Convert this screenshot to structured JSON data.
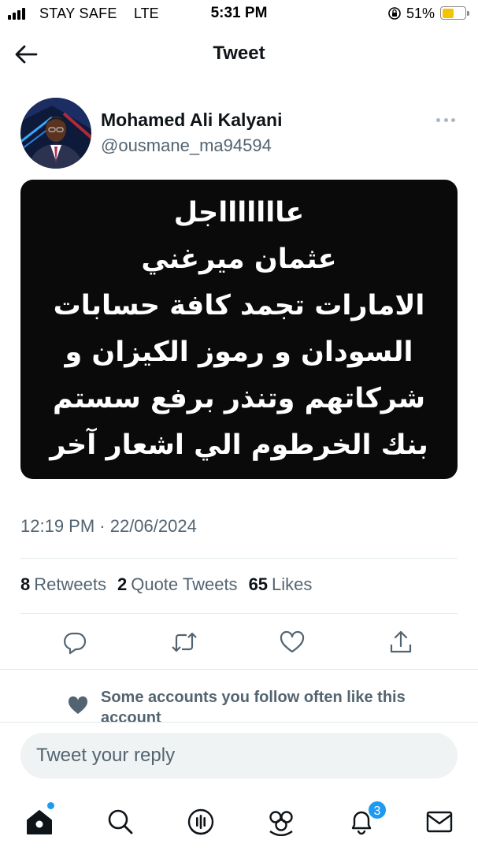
{
  "status_bar": {
    "carrier": "STAY SAFE",
    "network": "LTE",
    "time": "5:31 PM",
    "battery_percent": "51%",
    "battery_level": 0.51,
    "battery_color": "#f5c400"
  },
  "header": {
    "title": "Tweet",
    "back_icon": "arrow-left-icon"
  },
  "tweet": {
    "author_name": "Mohamed Ali Kalyani",
    "author_handle": "@ousmane_ma94594",
    "media_text_lines": [
      "عاااااااجل",
      "عثمان ميرغني",
      "الامارات تجمد كافة حسابات",
      "السودان و رموز الكيزان و",
      "شركاتهم وتنذر برفع سستم",
      "بنك الخرطوم الي اشعار آخر"
    ],
    "timestamp": "12:19 PM · 22/06/2024",
    "stats": {
      "retweets_count": "8",
      "retweets_label": "Retweets",
      "quotes_count": "2",
      "quotes_label": "Quote Tweets",
      "likes_count": "65",
      "likes_label": "Likes"
    },
    "actions": [
      "reply-icon",
      "retweet-icon",
      "like-icon",
      "share-icon"
    ]
  },
  "social_context": {
    "icon": "heart-icon",
    "text": "Some accounts you follow often like this account"
  },
  "reply": {
    "placeholder": "Tweet your reply",
    "value": ""
  },
  "tabbar": {
    "items": [
      "home-icon",
      "search-icon",
      "spaces-icon",
      "communities-icon",
      "notifications-icon",
      "messages-icon"
    ],
    "notifications_badge": "3",
    "accent": "#1d9bf0"
  }
}
